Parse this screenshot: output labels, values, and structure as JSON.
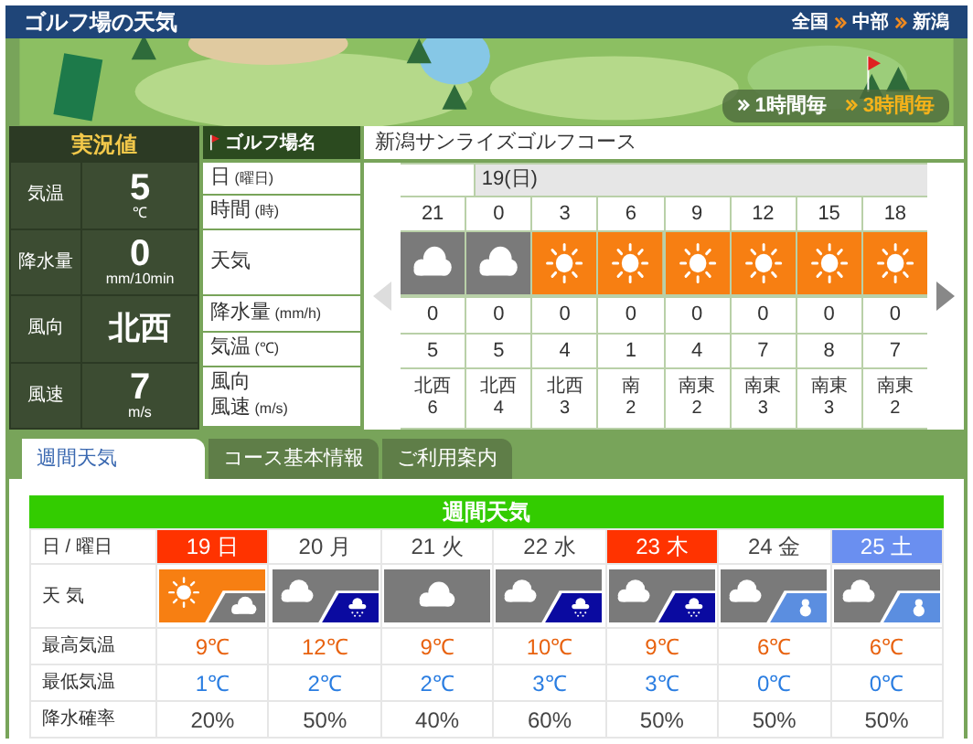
{
  "header": {
    "title": "ゴルフ場の天気",
    "breadcrumb": [
      "全国",
      "中部",
      "新潟"
    ]
  },
  "interval_toggle": [
    {
      "label": "1時間毎",
      "selected": false
    },
    {
      "label": "3時間毎",
      "selected": true
    }
  ],
  "current": {
    "title": "実況値",
    "rows": [
      {
        "kind": "value",
        "label": "気温",
        "value": "5",
        "unit": "℃"
      },
      {
        "kind": "value",
        "label": "降水量",
        "value": "0",
        "unit": "mm/10min"
      },
      {
        "kind": "direction",
        "label": "風向",
        "value": "北西"
      },
      {
        "kind": "value",
        "label": "風速",
        "value": "7",
        "unit": "m/s"
      }
    ]
  },
  "course": {
    "label": "ゴルフ場名",
    "name": "新潟サンライズゴルフコース"
  },
  "row_labels": [
    {
      "label": "日",
      "unit": "(曜日)"
    },
    {
      "label": "時間",
      "unit": "(時)"
    },
    {
      "label": "天気"
    },
    {
      "label": "降水量",
      "unit": "(mm/h)"
    },
    {
      "label": "気温",
      "unit": "(℃)"
    },
    {
      "label": "風向",
      "label2": "風速",
      "unit": "(m/s)"
    }
  ],
  "hourly": {
    "prev_disabled": true,
    "next_disabled": false,
    "days": [
      {
        "hours": [
          {
            "hour": "21",
            "kind": "cloudy",
            "precip": "0",
            "temp": "5",
            "wind_dir": "北西",
            "wind_speed": "6"
          }
        ]
      },
      {
        "label": "19(日)",
        "hours": [
          {
            "hour": "0",
            "kind": "cloudy",
            "precip": "0",
            "temp": "5",
            "wind_dir": "北西",
            "wind_speed": "4"
          },
          {
            "hour": "3",
            "kind": "sunny",
            "precip": "0",
            "temp": "4",
            "wind_dir": "北西",
            "wind_speed": "3"
          },
          {
            "hour": "6",
            "kind": "sunny",
            "precip": "0",
            "temp": "1",
            "wind_dir": "南",
            "wind_speed": "2"
          },
          {
            "hour": "9",
            "kind": "sunny",
            "precip": "0",
            "temp": "4",
            "wind_dir": "南東",
            "wind_speed": "2"
          },
          {
            "hour": "12",
            "kind": "sunny",
            "precip": "0",
            "temp": "7",
            "wind_dir": "南東",
            "wind_speed": "3"
          },
          {
            "hour": "15",
            "kind": "sunny",
            "precip": "0",
            "temp": "8",
            "wind_dir": "南東",
            "wind_speed": "3"
          },
          {
            "hour": "18",
            "kind": "sunny",
            "precip": "0",
            "temp": "7",
            "wind_dir": "南東",
            "wind_speed": "2"
          }
        ]
      }
    ]
  },
  "tabs": [
    {
      "label": "週間天気",
      "selected": true
    },
    {
      "label": "コース基本情報",
      "selected": false
    },
    {
      "label": "ご利用案内",
      "selected": false
    }
  ],
  "weekly": {
    "title": "週間天気",
    "labels": [
      "日 / 曜日",
      "天 気",
      "最高気温",
      "最低気温",
      "降水確率"
    ],
    "days": [
      {
        "date": "19 日",
        "color": "#ff3300",
        "kind": "sunny_cloudy",
        "high": "9℃",
        "low": "1℃",
        "pop": "20%"
      },
      {
        "date": "20 月",
        "kind": "cloudy_rain",
        "high": "12℃",
        "low": "2℃",
        "pop": "50%"
      },
      {
        "date": "21 火",
        "kind": "cloudy",
        "high": "9℃",
        "low": "2℃",
        "pop": "40%"
      },
      {
        "date": "22 水",
        "kind": "cloudy_rain",
        "high": "10℃",
        "low": "3℃",
        "pop": "60%"
      },
      {
        "date": "23 木",
        "color": "#ff3300",
        "kind": "cloudy_rain",
        "high": "9℃",
        "low": "3℃",
        "pop": "50%"
      },
      {
        "date": "24 金",
        "kind": "cloudy_snow",
        "high": "6℃",
        "low": "0℃",
        "pop": "50%"
      },
      {
        "date": "25 土",
        "color": "#6a8ff0",
        "kind": "cloudy_snow",
        "high": "6℃",
        "low": "0℃",
        "pop": "50%"
      }
    ]
  }
}
